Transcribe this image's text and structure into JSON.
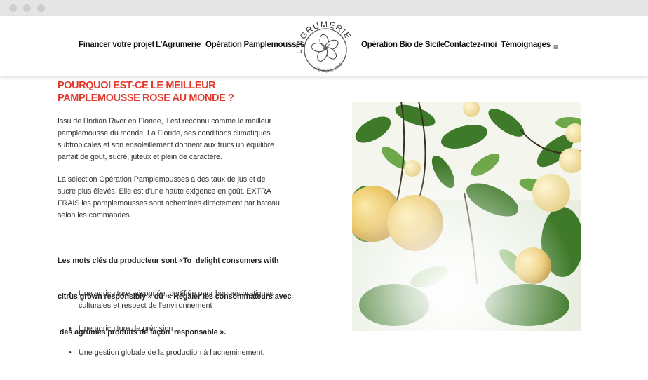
{
  "colors": {
    "accent": "#e23b2e",
    "chrome": "#e5e5e5",
    "text": "#333333"
  },
  "logo": {
    "arc_text": "L'AGRUMERIE",
    "tagline": "utile depuis 1990"
  },
  "nav": {
    "left": [
      "Financer votre projet",
      "L'Agrumerie",
      "Opération Pamplemousses"
    ],
    "right": [
      "Opération Bio de Sicile",
      "Contactez-moi",
      "Témoignages"
    ],
    "menu_icon": "≡"
  },
  "article": {
    "title": "POURQUOI EST-CE LE MEILLEUR PAMPLEMOUSSE ROSE AU MONDE ?",
    "paragraph1_lines": [
      "Issu de l'Indian River en Floride, il est reconnu comme le meilleur",
      "pamplemousse du monde. La Floride, ses conditions climatiques",
      "subtropicales et son ensoleillement donnent aux fruits un équilibre",
      "parfait de goût, sucré, juteux et plein de caractère."
    ],
    "paragraph2_lines": [
      "La sélection  Opération Pamplemousses a des taux de jus et de",
      "sucre plus élevés. Elle est d'une haute exigence en goût. EXTRA",
      "FRAIS les pamplemousses sont acheminés directement par bateau",
      "selon les commandes."
    ],
    "paragraph3_lines": [
      "Les mots clés du producteur sont «To  delight consumers with",
      "citrus grown responsibly » ou  « Régaler les consommateurs avec",
      " des agrumes produits de façon  responsable »."
    ],
    "bullets": [
      [
        "Une agriculture raisonnée, certifiée pour bonnes pratiques",
        "culturales et respect de l'environnement"
      ],
      [
        "Une agriculture de précision"
      ],
      [
        "Une gestion globale de la production à l'acheminement."
      ]
    ]
  },
  "image": {
    "subject": "grapefruits-on-tree-photo"
  }
}
